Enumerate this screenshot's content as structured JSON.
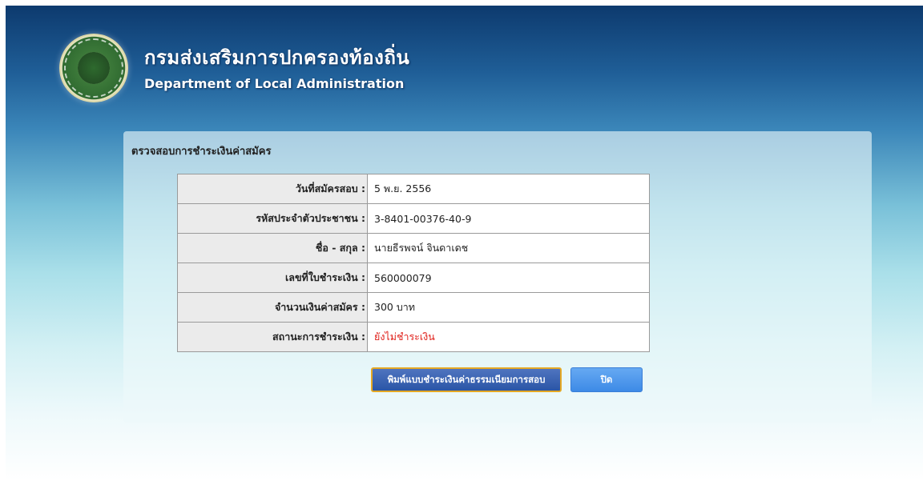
{
  "header": {
    "title_th": "กรมส่งเสริมการปกครองท้องถิ่น",
    "title_en": "Department of Local Administration",
    "logo_icon": "department-seal-icon"
  },
  "panel": {
    "title": "ตรวจสอบการชำระเงินค่าสมัคร"
  },
  "details": [
    {
      "label": "วันที่สมัครสอบ :",
      "value": "5 พ.ย. 2556"
    },
    {
      "label": "รหัสประจำตัวประชาชน :",
      "value": "3-8401-00376-40-9"
    },
    {
      "label": "ชื่อ - สกุล :",
      "value": "นายธีรพจน์ จินดาเดช"
    },
    {
      "label": "เลขที่ใบชำระเงิน :",
      "value": "560000079"
    },
    {
      "label": "จำนวนเงินค่าสมัคร :",
      "value": "300 บาท"
    },
    {
      "label": "สถานะการชำระเงิน :",
      "value": "ยังไม่ชำระเงิน"
    }
  ],
  "buttons": {
    "print_label": "พิมพ์แบบชำระเงินค่าธรรมเนียมการสอบ",
    "close_label": "ปิด"
  },
  "colors": {
    "status_unpaid": "#e0201a",
    "print_button": "#2a55a6",
    "close_button": "#3d8ae6"
  }
}
